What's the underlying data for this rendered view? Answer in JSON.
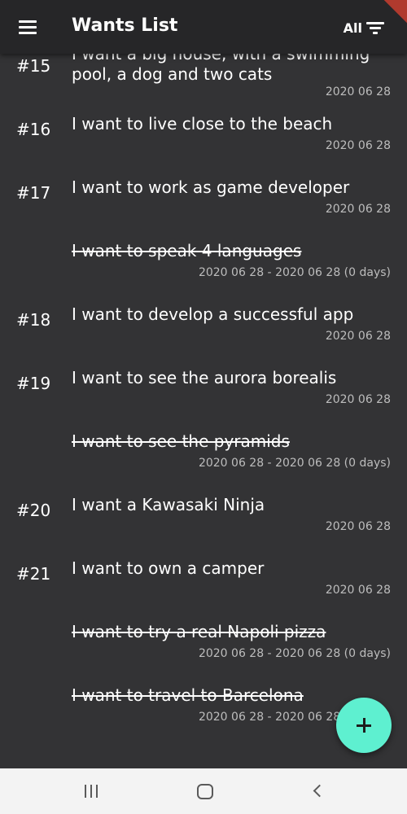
{
  "appbar": {
    "title": "Wants List",
    "filter_label": "All",
    "menu_icon": "hamburger-menu-icon",
    "filter_icon": "filter-list-icon"
  },
  "wants": [
    {
      "number": "#15",
      "text": "I want a big house, with a swimming pool, a dog and two cats",
      "date": "2020 06 28",
      "done": false
    },
    {
      "number": "#16",
      "text": "I want to live close to the beach",
      "date": "2020 06 28",
      "done": false
    },
    {
      "number": "#17",
      "text": "I want to work as game developer",
      "date": "2020 06 28",
      "done": false
    },
    {
      "number": "",
      "text": "I want to speak 4 languages",
      "date": "2020 06 28 - 2020 06 28 (0 days)",
      "done": true
    },
    {
      "number": "#18",
      "text": "I want to develop a  successful app",
      "date": "2020 06 28",
      "done": false
    },
    {
      "number": "#19",
      "text": "I want to see the aurora borealis",
      "date": "2020 06 28",
      "done": false
    },
    {
      "number": "",
      "text": "I want to see the pyramids",
      "date": "2020 06 28 - 2020 06 28 (0 days)",
      "done": true
    },
    {
      "number": "#20",
      "text": "I want a Kawasaki Ninja",
      "date": "2020 06 28",
      "done": false
    },
    {
      "number": "#21",
      "text": "I want to own a camper",
      "date": "2020 06 28",
      "done": false
    },
    {
      "number": "",
      "text": "I want to try a real Napoli pizza",
      "date": "2020 06 28 - 2020 06 28 (0 days)",
      "done": true
    },
    {
      "number": "",
      "text": "I want to travel to Barcelona",
      "date": "2020 06 28 - 2020 06 28 (0 days)",
      "done": true
    }
  ],
  "fab": {
    "icon": "plus-icon"
  },
  "navbar": {
    "recents_icon": "recents-icon",
    "home_icon": "home-icon",
    "back_icon": "back-icon"
  },
  "colors": {
    "background": "#333335",
    "appbar": "#262628",
    "fab": "#5ef0d0",
    "date_text": "#bdbdbd",
    "navbar": "#f3f3f3"
  }
}
